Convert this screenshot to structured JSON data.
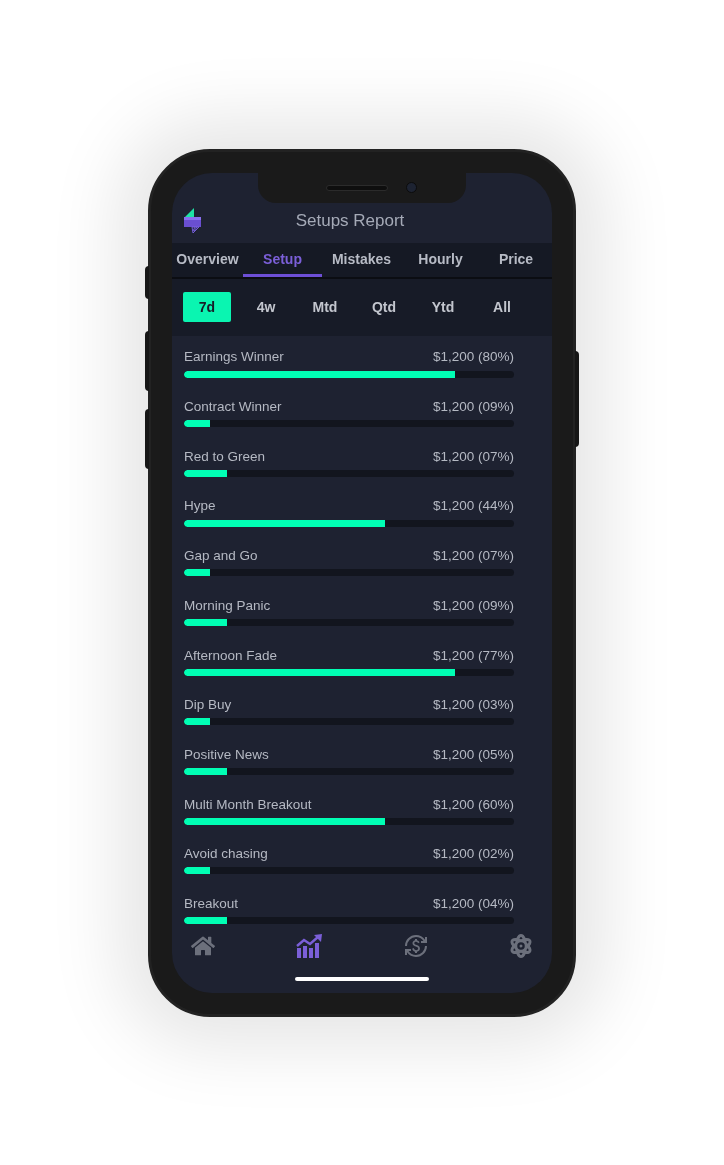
{
  "window": {
    "title": "Setups Report"
  },
  "tabs": [
    {
      "label": "Overview",
      "selected": false
    },
    {
      "label": "Setup",
      "selected": true
    },
    {
      "label": "Mistakes",
      "selected": false
    },
    {
      "label": "Hourly",
      "selected": false
    },
    {
      "label": "Price",
      "selected": false
    }
  ],
  "ranges": [
    {
      "label": "7d",
      "selected": true
    },
    {
      "label": "4w",
      "selected": false
    },
    {
      "label": "Mtd",
      "selected": false
    },
    {
      "label": "Qtd",
      "selected": false
    },
    {
      "label": "Ytd",
      "selected": false
    },
    {
      "label": "All",
      "selected": false
    }
  ],
  "setups": [
    {
      "name": "Earnings Winner",
      "reading": "$1,200 (80%)",
      "level": 0.82
    },
    {
      "name": "Contract Winner",
      "reading": "$1,200 (09%)",
      "level": 0.08
    },
    {
      "name": "Red to Green",
      "reading": "$1,200 (07%)",
      "level": 0.13
    },
    {
      "name": "Hype",
      "reading": "$1,200 (44%)",
      "level": 0.61
    },
    {
      "name": "Gap and Go",
      "reading": "$1,200 (07%)",
      "level": 0.08
    },
    {
      "name": "Morning Panic",
      "reading": "$1,200 (09%)",
      "level": 0.13
    },
    {
      "name": "Afternoon Fade",
      "reading": "$1,200 (77%)",
      "level": 0.82
    },
    {
      "name": "Dip Buy",
      "reading": "$1,200 (03%)",
      "level": 0.08
    },
    {
      "name": "Positive News",
      "reading": "$1,200 (05%)",
      "level": 0.13
    },
    {
      "name": "Multi Month Breakout",
      "reading": "$1,200 (60%)",
      "level": 0.61
    },
    {
      "name": "Avoid chasing",
      "reading": "$1,200 (02%)",
      "level": 0.08
    },
    {
      "name": "Breakout",
      "reading": "$1,200 (04%)",
      "level": 0.13
    }
  ],
  "tab_bar": [
    {
      "selected": false
    },
    {
      "selected": true
    },
    {
      "selected": false
    },
    {
      "selected": false
    }
  ]
}
